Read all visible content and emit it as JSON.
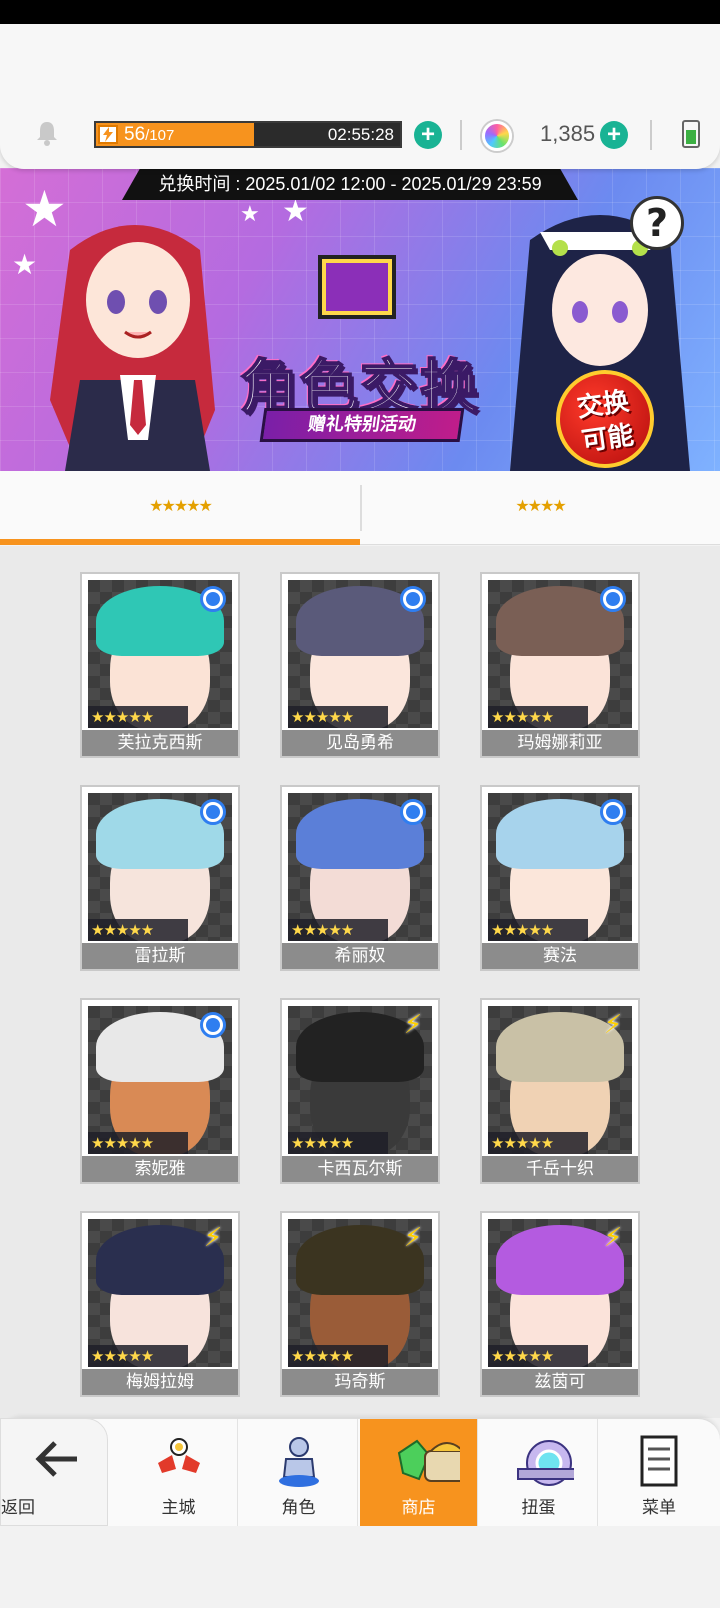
{
  "header": {
    "stamina_current": "56",
    "stamina_max": "/107",
    "stamina_fraction": 0.52,
    "stamina_timer": "02:55:28",
    "gem_count": "1,385",
    "accent": "#f7931e",
    "plus_color": "#19b394"
  },
  "banner": {
    "exchange_time": "兑换时间 : 2025.01/02 12:00 - 2025.01/29 23:59",
    "title": "角色交换",
    "subtitle": "赠礼特别活动",
    "seal": "交换可能",
    "help_icon": "?"
  },
  "tabs": [
    {
      "label": "★★★★★",
      "active": true
    },
    {
      "label": "★★★★",
      "active": false
    }
  ],
  "characters": [
    {
      "name": "芙拉克西斯",
      "stars": "★★★★★",
      "badge": "circle",
      "hair": "#2fc7b5",
      "skin": "#fbe3d6"
    },
    {
      "name": "见岛勇希",
      "stars": "★★★★★",
      "badge": "circle",
      "hair": "#5a5a7a",
      "skin": "#fbe6dc"
    },
    {
      "name": "玛姆娜莉亚",
      "stars": "★★★★★",
      "badge": "circle",
      "hair": "#7a5f55",
      "skin": "#fbe3d8"
    },
    {
      "name": "雷拉斯",
      "stars": "★★★★★",
      "badge": "circle",
      "hair": "#9fd9e8",
      "skin": "#f6e4dc"
    },
    {
      "name": "希丽奴",
      "stars": "★★★★★",
      "badge": "circle",
      "hair": "#5b7fd8",
      "skin": "#f3dcd6"
    },
    {
      "name": "赛法",
      "stars": "★★★★★",
      "badge": "circle",
      "hair": "#a7d3ec",
      "skin": "#fbe6da"
    },
    {
      "name": "索妮雅",
      "stars": "★★★★★",
      "badge": "circle",
      "hair": "#e8e8e8",
      "skin": "#d98a55"
    },
    {
      "name": "卡西瓦尔斯",
      "stars": "★★★★★",
      "badge": "bolt",
      "hair": "#222222",
      "skin": "#3a3a3a"
    },
    {
      "name": "千岳十织",
      "stars": "★★★★★",
      "badge": "bolt",
      "hair": "#c9c1a6",
      "skin": "#f0d2b4"
    },
    {
      "name": "梅姆拉姆",
      "stars": "★★★★★",
      "badge": "bolt",
      "hair": "#2a2f4f",
      "skin": "#f7e3dc"
    },
    {
      "name": "玛奇斯",
      "stars": "★★★★★",
      "badge": "bolt",
      "hair": "#3b3420",
      "skin": "#9a5c38"
    },
    {
      "name": "兹茵可",
      "stars": "★★★★★",
      "badge": "bolt",
      "hair": "#b45be0",
      "skin": "#fbe3da"
    }
  ],
  "nav": {
    "back": "返回",
    "items": [
      {
        "label": "主城",
        "icon": "castle-icon"
      },
      {
        "label": "角色",
        "icon": "character-icon"
      },
      {
        "label": "商店",
        "icon": "shop-icon",
        "active": true
      },
      {
        "label": "扭蛋",
        "icon": "gacha-icon"
      },
      {
        "label": "菜单",
        "icon": "menu-icon"
      }
    ]
  }
}
